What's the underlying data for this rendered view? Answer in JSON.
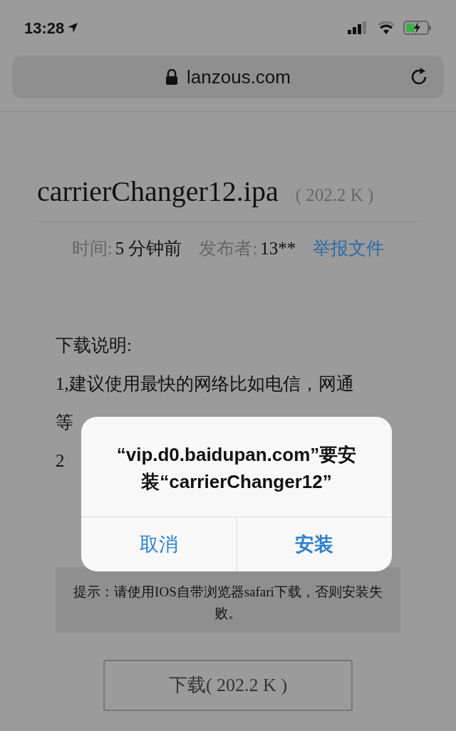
{
  "status_bar": {
    "time": "13:28"
  },
  "address_bar": {
    "url": "lanzous.com"
  },
  "file": {
    "name": "carrierChanger12.ipa",
    "size": "( 202.2 K )"
  },
  "meta": [
    {
      "label": "时间:",
      "value": "5 分钟前"
    },
    {
      "label": "发布者:",
      "value": "13**"
    }
  ],
  "report_link": "举报文件",
  "instructions": [
    "下载说明:",
    "1,建议使用最快的网络比如电信，网通",
    "等",
    "2"
  ],
  "tip": "提示：请使用IOS自带浏览器safari下载，否则安装失败。",
  "download_button": "下载( 202.2 K )",
  "dialog": {
    "message": "“vip.d0.baidupan.com”要安装“carrierChanger12”",
    "buttons": [
      {
        "label": "取消",
        "kind": "cancel"
      },
      {
        "label": "安装",
        "kind": "default"
      }
    ]
  }
}
